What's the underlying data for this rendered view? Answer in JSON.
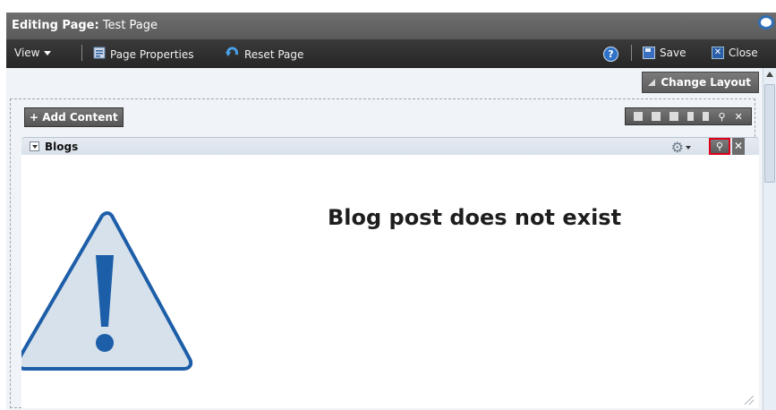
{
  "titlebar": {
    "label": "Editing Page:",
    "page_name": "Test Page"
  },
  "toolbar": {
    "view_label": "View",
    "page_properties_label": "Page Properties",
    "reset_page_label": "Reset Page",
    "save_label": "Save",
    "close_label": "Close"
  },
  "page": {
    "change_layout_label": "Change Layout",
    "add_content_label": "+ Add Content"
  },
  "blog": {
    "title": "Blogs",
    "message": "Blog post does not exist"
  },
  "colors": {
    "titlebar": "#5f5f5f",
    "toolbar": "#2e2e2e",
    "accent_blue": "#2f73c9",
    "highlight_red": "#e0001a",
    "warning_fill": "#d6e1eb",
    "warning_stroke": "#1d5ea8"
  },
  "icons": [
    "view-caret-icon",
    "page-properties-icon",
    "reset-page-icon",
    "help-icon",
    "save-icon",
    "close-icon",
    "oracle-logo-icon",
    "change-layout-icon",
    "layout-tool-icons",
    "gear-icon",
    "edit-wrench-icon",
    "remove-icon",
    "warning-icon",
    "resize-grip-icon"
  ]
}
